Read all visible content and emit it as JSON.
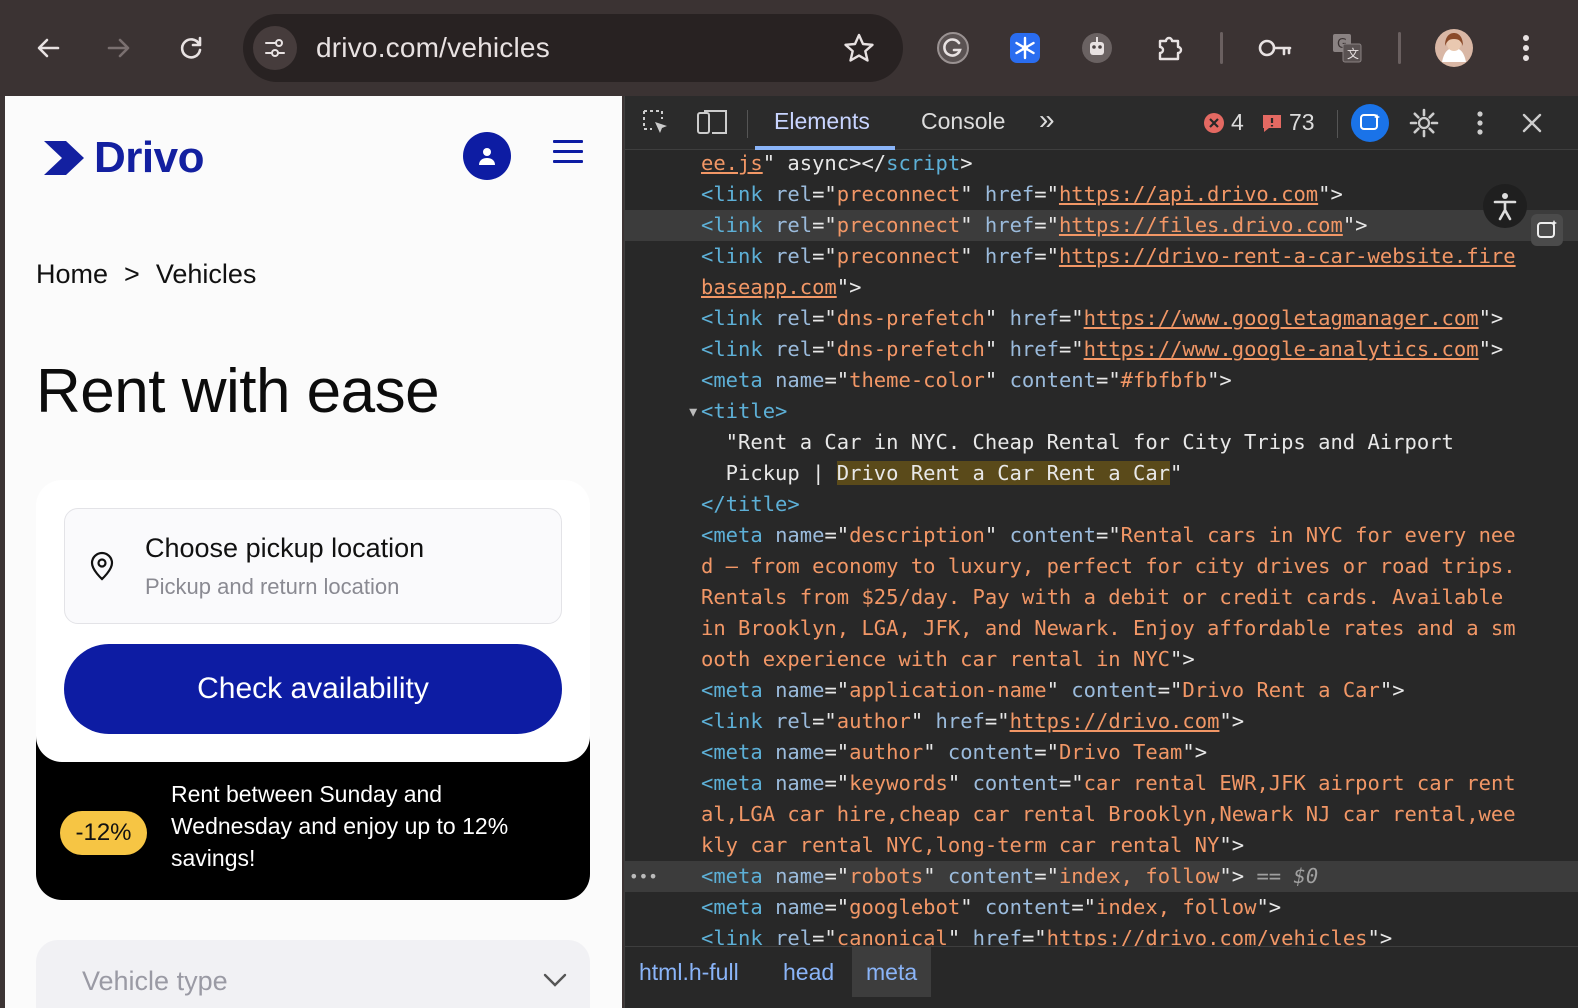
{
  "browser": {
    "url": "drivo.com/vehicles",
    "avatar_initial": "",
    "colors": {
      "chrome": "#3b3333",
      "omnibox": "#282222"
    }
  },
  "site": {
    "logo_text": "Drivo",
    "breadcrumb": {
      "home": "Home",
      "separator": ">",
      "current": "Vehicles"
    },
    "hero_title": "Rent with ease",
    "pickup": {
      "label": "Choose pickup location",
      "sublabel": "Pickup and return location"
    },
    "check_button": "Check availability",
    "promo": {
      "badge": "-12%",
      "text": "Rent between Sunday and Wednesday and enjoy up to 12% savings!"
    },
    "vehicle_type": "Vehicle type",
    "colors": {
      "brand": "#0d1ca3",
      "promo_badge": "#f6c544"
    }
  },
  "devtools": {
    "tabs": {
      "elements": "Elements",
      "console": "Console",
      "more": "»"
    },
    "errors_count": "4",
    "warnings_count": "73",
    "lines": [
      {
        "parts": [
          [
            "u",
            "ee.js"
          ],
          [
            "w",
            "\" async></"
          ],
          [
            "t",
            "script"
          ],
          [
            "w",
            ">"
          ]
        ]
      },
      {
        "parts": [
          [
            "t",
            "<link "
          ],
          [
            "a",
            "rel"
          ],
          [
            "w",
            "=\""
          ],
          [
            "v",
            "preconnect"
          ],
          [
            "w",
            "\" "
          ],
          [
            "a",
            "href"
          ],
          [
            "w",
            "=\""
          ],
          [
            "u",
            "https://api.drivo.com"
          ],
          [
            "w",
            "\">"
          ]
        ]
      },
      {
        "parts": [
          [
            "t",
            "<link "
          ],
          [
            "a",
            "rel"
          ],
          [
            "w",
            "=\""
          ],
          [
            "v",
            "preconnect"
          ],
          [
            "w",
            "\" "
          ],
          [
            "a",
            "href"
          ],
          [
            "w",
            "=\""
          ],
          [
            "u",
            "https://files.drivo.com"
          ],
          [
            "w",
            "\">"
          ]
        ],
        "highlight": true
      },
      {
        "parts": [
          [
            "t",
            "<link "
          ],
          [
            "a",
            "rel"
          ],
          [
            "w",
            "=\""
          ],
          [
            "v",
            "preconnect"
          ],
          [
            "w",
            "\" "
          ],
          [
            "a",
            "href"
          ],
          [
            "w",
            "=\""
          ],
          [
            "u",
            "https://drivo-rent-a-car-website.fire"
          ]
        ]
      },
      {
        "parts": [
          [
            "u",
            "baseapp.com"
          ],
          [
            "w",
            "\">"
          ]
        ]
      },
      {
        "parts": [
          [
            "t",
            "<link "
          ],
          [
            "a",
            "rel"
          ],
          [
            "w",
            "=\""
          ],
          [
            "v",
            "dns-prefetch"
          ],
          [
            "w",
            "\" "
          ],
          [
            "a",
            "href"
          ],
          [
            "w",
            "=\""
          ],
          [
            "u",
            "https://www.googletagmanager.com"
          ],
          [
            "w",
            "\">"
          ]
        ]
      },
      {
        "parts": [
          [
            "t",
            "<link "
          ],
          [
            "a",
            "rel"
          ],
          [
            "w",
            "=\""
          ],
          [
            "v",
            "dns-prefetch"
          ],
          [
            "w",
            "\" "
          ],
          [
            "a",
            "href"
          ],
          [
            "w",
            "=\""
          ],
          [
            "u",
            "https://www.google-analytics.com"
          ],
          [
            "w",
            "\">"
          ]
        ]
      },
      {
        "parts": [
          [
            "t",
            "<meta "
          ],
          [
            "a",
            "name"
          ],
          [
            "w",
            "=\""
          ],
          [
            "v",
            "theme-color"
          ],
          [
            "w",
            "\" "
          ],
          [
            "a",
            "content"
          ],
          [
            "w",
            "=\""
          ],
          [
            "v",
            "#fbfbfb"
          ],
          [
            "w",
            "\">"
          ]
        ]
      },
      {
        "parts": [
          [
            "t",
            "<title>"
          ]
        ],
        "expanded": true
      },
      {
        "parts": [
          [
            "w",
            "  \"Rent a Car in NYC. Cheap Rental for City Trips and Airport"
          ]
        ]
      },
      {
        "parts": [
          [
            "w",
            "  Pickup | "
          ],
          [
            "y",
            "Drivo Rent a Car Rent a Car"
          ],
          [
            "w",
            "\""
          ]
        ]
      },
      {
        "parts": [
          [
            "t",
            "</title>"
          ]
        ]
      },
      {
        "parts": [
          [
            "t",
            "<meta "
          ],
          [
            "a",
            "name"
          ],
          [
            "w",
            "=\""
          ],
          [
            "v",
            "description"
          ],
          [
            "w",
            "\" "
          ],
          [
            "a",
            "content"
          ],
          [
            "w",
            "=\""
          ],
          [
            "v",
            "Rental cars in NYC for every nee"
          ]
        ]
      },
      {
        "parts": [
          [
            "v",
            "d – from economy to luxury, perfect for city drives or road trips."
          ]
        ]
      },
      {
        "parts": [
          [
            "v",
            "Rentals from $25/day. Pay with a debit or credit cards. Available"
          ]
        ]
      },
      {
        "parts": [
          [
            "v",
            "in Brooklyn, LGA, JFK, and Newark. Enjoy affordable rates and a sm"
          ]
        ]
      },
      {
        "parts": [
          [
            "v",
            "ooth experience with car rental in NYC"
          ],
          [
            "w",
            "\">"
          ]
        ]
      },
      {
        "parts": [
          [
            "t",
            "<meta "
          ],
          [
            "a",
            "name"
          ],
          [
            "w",
            "=\""
          ],
          [
            "v",
            "application-name"
          ],
          [
            "w",
            "\" "
          ],
          [
            "a",
            "content"
          ],
          [
            "w",
            "=\""
          ],
          [
            "v",
            "Drivo Rent a Car"
          ],
          [
            "w",
            "\">"
          ]
        ]
      },
      {
        "parts": [
          [
            "t",
            "<link "
          ],
          [
            "a",
            "rel"
          ],
          [
            "w",
            "=\""
          ],
          [
            "v",
            "author"
          ],
          [
            "w",
            "\" "
          ],
          [
            "a",
            "href"
          ],
          [
            "w",
            "=\""
          ],
          [
            "u",
            "https://drivo.com"
          ],
          [
            "w",
            "\">"
          ]
        ]
      },
      {
        "parts": [
          [
            "t",
            "<meta "
          ],
          [
            "a",
            "name"
          ],
          [
            "w",
            "=\""
          ],
          [
            "v",
            "author"
          ],
          [
            "w",
            "\" "
          ],
          [
            "a",
            "content"
          ],
          [
            "w",
            "=\""
          ],
          [
            "v",
            "Drivo Team"
          ],
          [
            "w",
            "\">"
          ]
        ]
      },
      {
        "parts": [
          [
            "t",
            "<meta "
          ],
          [
            "a",
            "name"
          ],
          [
            "w",
            "=\""
          ],
          [
            "v",
            "keywords"
          ],
          [
            "w",
            "\" "
          ],
          [
            "a",
            "content"
          ],
          [
            "w",
            "=\""
          ],
          [
            "v",
            "car rental EWR,JFK airport car rent"
          ]
        ]
      },
      {
        "parts": [
          [
            "v",
            "al,LGA car hire,cheap car rental Brooklyn,Newark NJ car rental,wee"
          ]
        ]
      },
      {
        "parts": [
          [
            "v",
            "kly car rental NYC,long-term car rental NY"
          ],
          [
            "w",
            "\">"
          ]
        ]
      },
      {
        "parts": [
          [
            "t",
            "<meta "
          ],
          [
            "a",
            "name"
          ],
          [
            "w",
            "=\""
          ],
          [
            "v",
            "robots"
          ],
          [
            "w",
            "\" "
          ],
          [
            "a",
            "content"
          ],
          [
            "w",
            "=\""
          ],
          [
            "v",
            "index, follow"
          ],
          [
            "w",
            "\">"
          ],
          [
            "eq",
            " == $0"
          ]
        ],
        "selected": true
      },
      {
        "parts": [
          [
            "t",
            "<meta "
          ],
          [
            "a",
            "name"
          ],
          [
            "w",
            "=\""
          ],
          [
            "v",
            "googlebot"
          ],
          [
            "w",
            "\" "
          ],
          [
            "a",
            "content"
          ],
          [
            "w",
            "=\""
          ],
          [
            "v",
            "index, follow"
          ],
          [
            "w",
            "\">"
          ]
        ]
      },
      {
        "parts": [
          [
            "t",
            "<link "
          ],
          [
            "a",
            "rel"
          ],
          [
            "w",
            "=\""
          ],
          [
            "v",
            "canonical"
          ],
          [
            "w",
            "\" "
          ],
          [
            "a",
            "href"
          ],
          [
            "w",
            "=\""
          ],
          [
            "u",
            "https://drivo.com/vehicles"
          ],
          [
            "w",
            "\">"
          ]
        ]
      }
    ],
    "breadcrumbs": {
      "html": "html",
      "html_class": ".h-full",
      "head": "head",
      "meta": "meta"
    }
  }
}
